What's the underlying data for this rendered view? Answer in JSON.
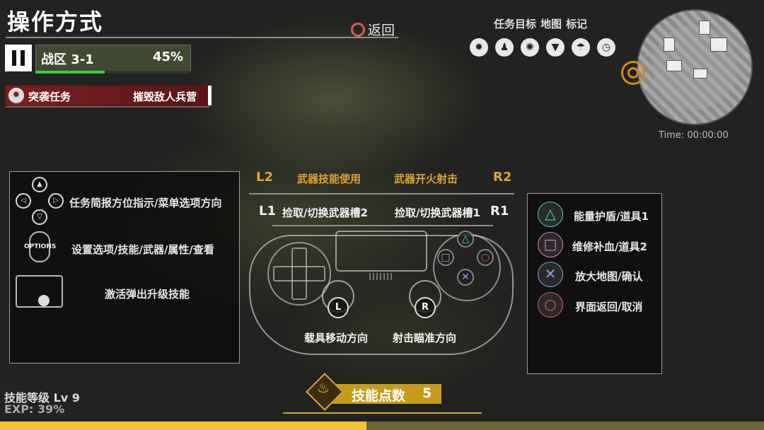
{
  "header": {
    "title": "操作方式",
    "back_label": "返回"
  },
  "hud": {
    "zone_name": "战区 3-1",
    "zone_progress_text": "45%",
    "zone_progress": 0.45,
    "mission_type": "突袭任务",
    "mission_goal": "摧毁敌人兵营"
  },
  "topnav": {
    "items": [
      "任务目标",
      "地图",
      "标记"
    ],
    "icons": [
      "target-icon",
      "squad-icon",
      "burst-icon",
      "shield-icon",
      "parachute-icon",
      "timer-icon"
    ],
    "time": "Time: 00:00:00"
  },
  "left_panel": {
    "dpad_text": "任务简报方位指示/菜单选项方向",
    "options_label": "OPTIONS",
    "options_text": "设置选项/技能/武器/属性/查看",
    "touchpad_text": "激活弹出升级技能"
  },
  "controller": {
    "l2": "L2",
    "r2": "R2",
    "l2_action": "武器技能使用",
    "r2_action": "武器开火射击",
    "l1": "L1",
    "r1": "R1",
    "l1_action": "捡取/切换武器槽2",
    "r1_action": "捡取/切换武器槽1",
    "left_stick": "L",
    "right_stick": "R",
    "left_stick_action": "载具移动方向",
    "right_stick_action": "射击瞄准方向"
  },
  "right_panel": {
    "items": [
      {
        "symbol": "△",
        "color": "#3fd9b6",
        "text": "能量护盾/道具1"
      },
      {
        "symbol": "□",
        "color": "#d97fc8",
        "text": "维修补血/道具2"
      },
      {
        "symbol": "✕",
        "color": "#7aa4e6",
        "text": "放大地图/确认"
      },
      {
        "symbol": "○",
        "color": "#e05a5a",
        "text": "界面返回/取消"
      }
    ]
  },
  "footer": {
    "skill_level": "技能等级 Lv 9",
    "exp": "EXP: 39%",
    "exp_progress": 0.48,
    "skill_points_label": "技能点数",
    "skill_points": "5"
  }
}
